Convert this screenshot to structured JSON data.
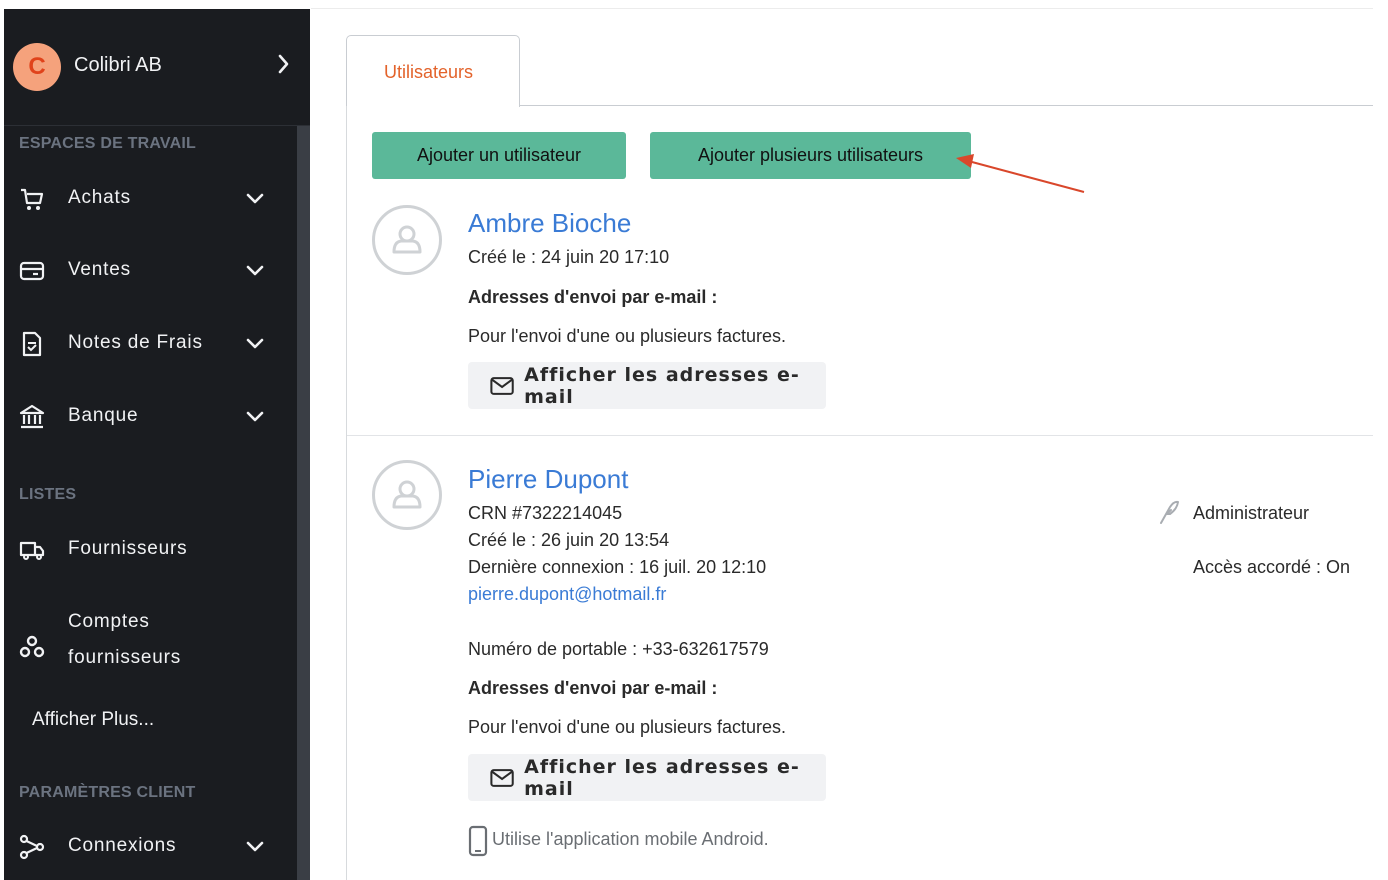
{
  "sidebar": {
    "org": {
      "initial": "C",
      "name": "Colibri AB"
    },
    "sections": {
      "workspaces": "ESPACES DE TRAVAIL",
      "lists": "LISTES",
      "client_settings": "PARAMÈTRES CLIENT"
    },
    "items": [
      {
        "label": "Achats",
        "icon": "cart-icon"
      },
      {
        "label": "Ventes",
        "icon": "wallet-icon"
      },
      {
        "label": "Notes de Frais",
        "icon": "receipt-icon"
      },
      {
        "label": "Banque",
        "icon": "bank-icon"
      },
      {
        "label": "Fournisseurs",
        "icon": "truck-icon"
      },
      {
        "label_line1": "Comptes",
        "label_line2": "fournisseurs",
        "icon": "accounts-icon"
      },
      {
        "label": "Connexions",
        "icon": "connections-icon"
      }
    ],
    "more": "Afficher Plus..."
  },
  "main": {
    "tab": "Utilisateurs",
    "buttons": {
      "add_user": "Ajouter un utilisateur",
      "add_multiple": "Ajouter plusieurs utilisateurs"
    },
    "users": [
      {
        "name": "Ambre Bioche",
        "created": "Créé le : 24 juin 20 17:10",
        "email_heading": "Adresses d'envoi par e-mail :",
        "email_desc": "Pour l'envoi d'une ou plusieurs factures.",
        "show_emails": "Afficher les adresses e-mail"
      },
      {
        "name": "Pierre Dupont",
        "crn": "CRN #7322214045",
        "created": "Créé le : 26 juin 20 13:54",
        "last_login": "Dernière connexion : 16 juil. 20 12:10",
        "email": "pierre.dupont@hotmail.fr",
        "mobile": "Numéro de portable : +33-632617579",
        "email_heading": "Adresses d'envoi par e-mail :",
        "email_desc": "Pour l'envoi d'une ou plusieurs factures.",
        "show_emails": "Afficher les adresses e-mail",
        "app_note": "Utilise l'application mobile Android.",
        "role": "Administrateur",
        "access": "Accès accordé : On"
      }
    ]
  },
  "colors": {
    "accent": "#e3632b",
    "button": "#5bb899",
    "link": "#3a7bd5",
    "sidebar": "#1a1c20",
    "arrow": "#d9472b"
  }
}
